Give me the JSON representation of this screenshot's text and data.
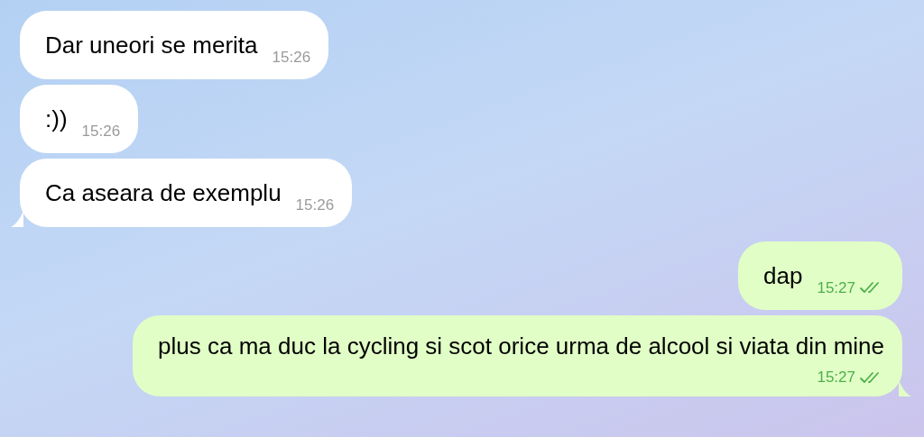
{
  "messages": [
    {
      "kind": "incoming",
      "text": "Dar uneori se merita",
      "time": "15:26",
      "tail": false
    },
    {
      "kind": "incoming",
      "text": ":))",
      "time": "15:26",
      "tail": false
    },
    {
      "kind": "incoming",
      "text": "Ca aseara de exemplu",
      "time": "15:26",
      "tail": true
    },
    {
      "kind": "outgoing",
      "text": "dap",
      "time": "15:27",
      "read": true,
      "tail": false
    },
    {
      "kind": "outgoing",
      "text": "plus ca ma duc la cycling si scot orice urma de alcool si viata din mine",
      "time": "15:27",
      "read": true,
      "tail": true
    }
  ]
}
